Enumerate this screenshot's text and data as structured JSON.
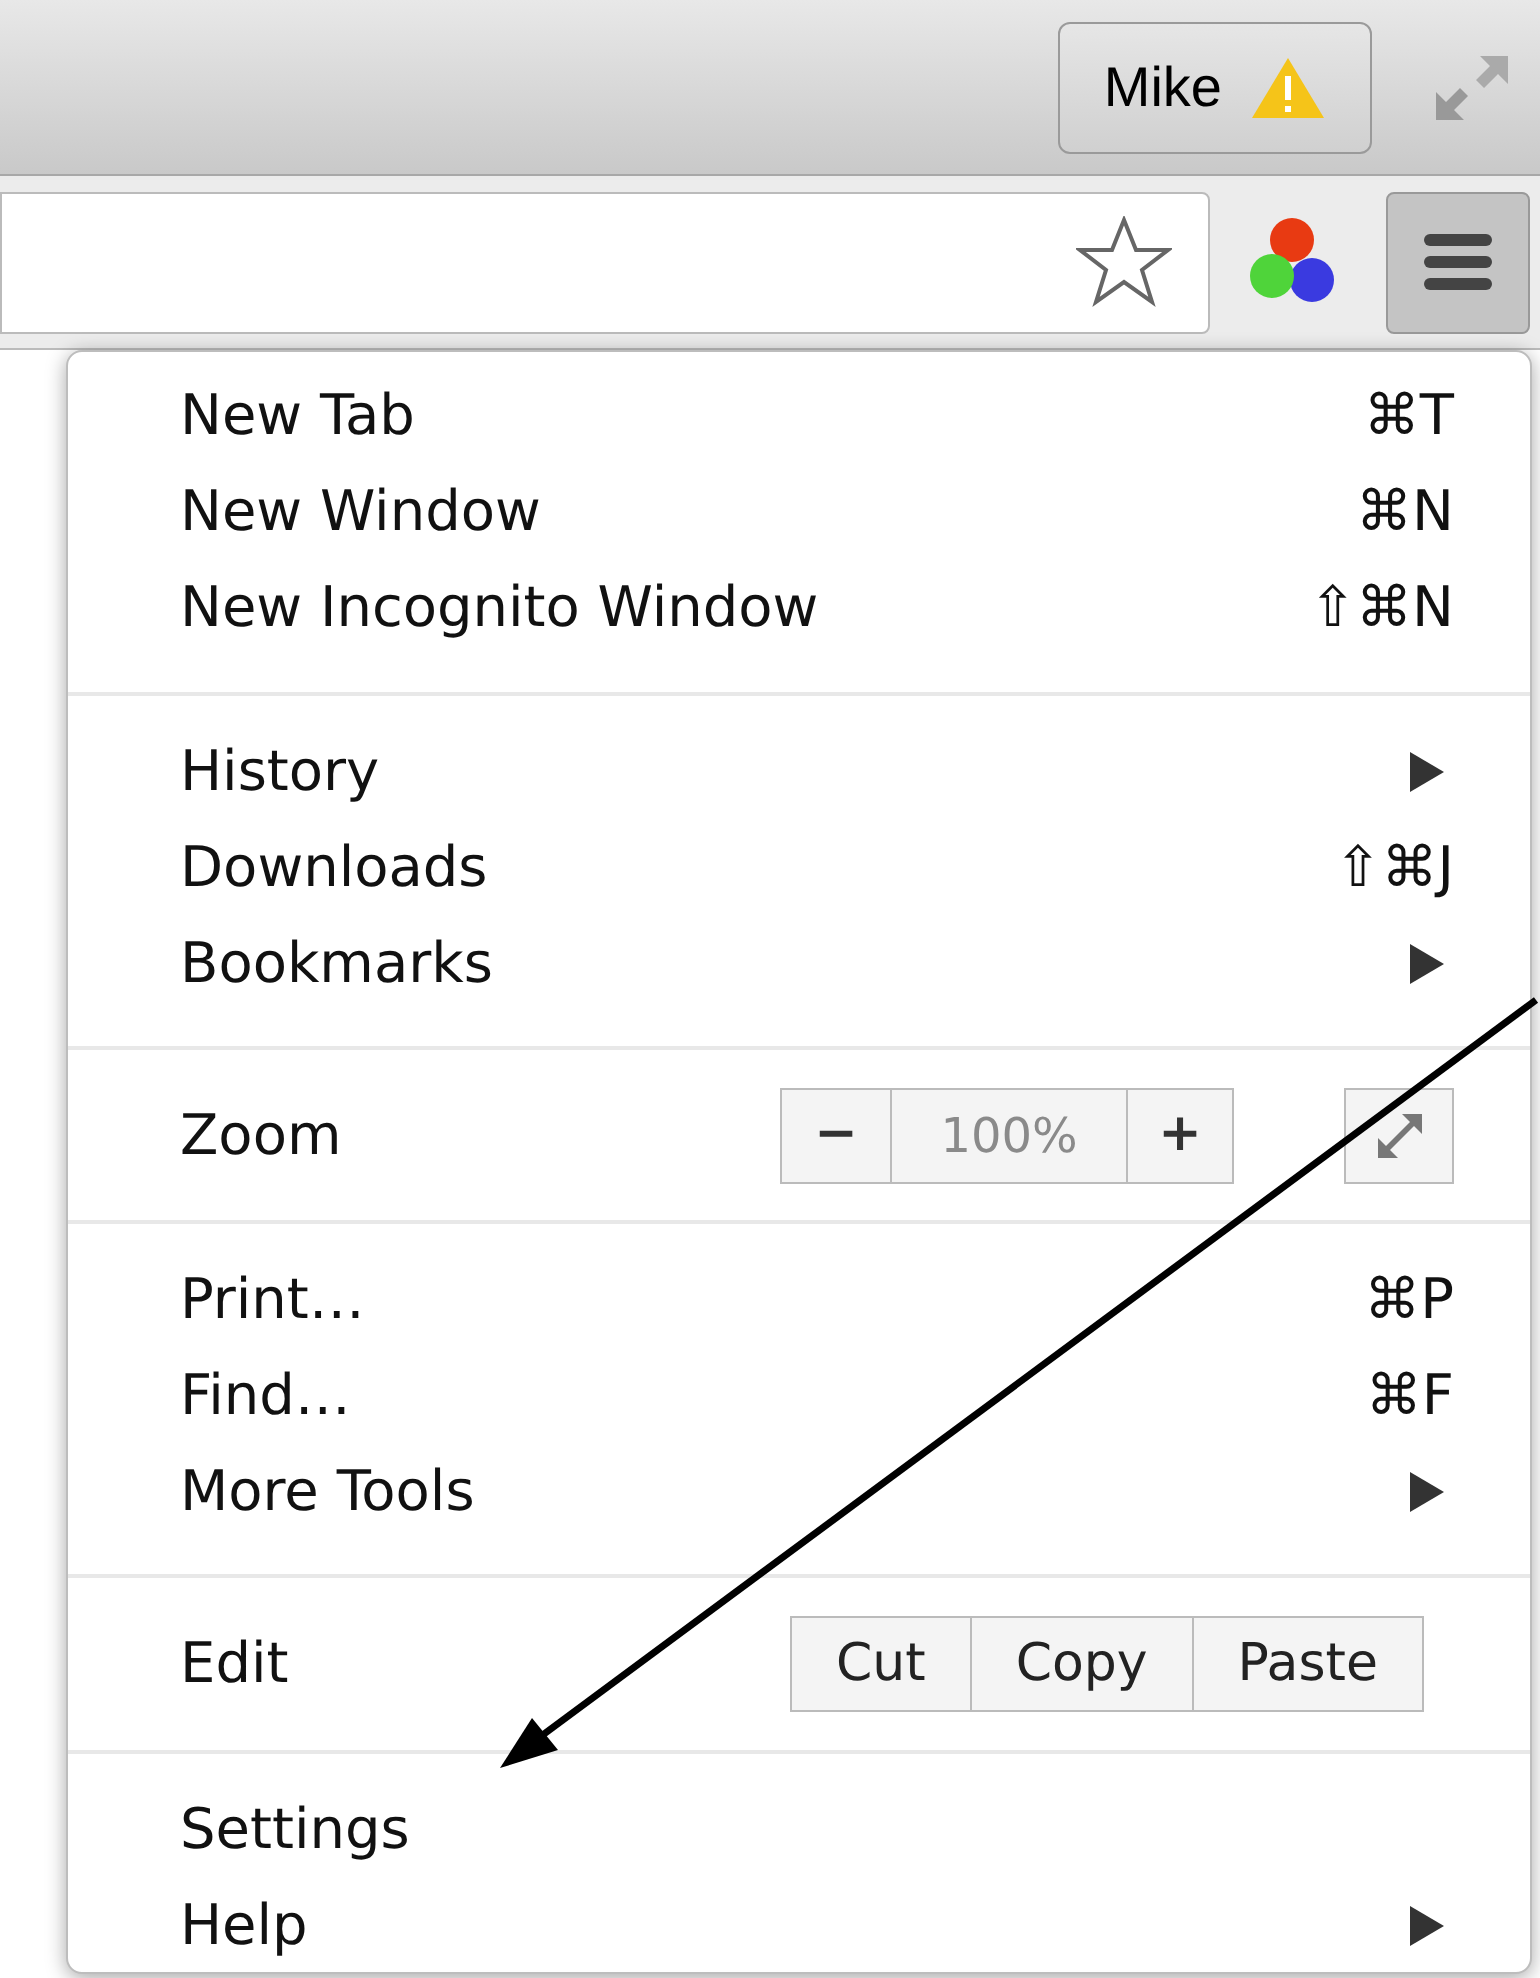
{
  "title_bar": {
    "profile_button": {
      "label": "Mike",
      "warning": true
    }
  },
  "menu": {
    "sections": [
      {
        "items": [
          {
            "kind": "command",
            "label": "New Tab",
            "shortcut": "⌘T"
          },
          {
            "kind": "command",
            "label": "New Window",
            "shortcut": "⌘N"
          },
          {
            "kind": "command",
            "label": "New Incognito Window",
            "shortcut": "⇧⌘N"
          }
        ]
      },
      {
        "items": [
          {
            "kind": "submenu",
            "label": "History"
          },
          {
            "kind": "command",
            "label": "Downloads",
            "shortcut": "⇧⌘J"
          },
          {
            "kind": "submenu",
            "label": "Bookmarks"
          }
        ]
      },
      {
        "items": [
          {
            "kind": "zoom",
            "label": "Zoom",
            "minus": "−",
            "value": "100%",
            "plus": "+"
          }
        ]
      },
      {
        "items": [
          {
            "kind": "command",
            "label": "Print…",
            "shortcut": "⌘P"
          },
          {
            "kind": "command",
            "label": "Find…",
            "shortcut": "⌘F"
          },
          {
            "kind": "submenu",
            "label": "More Tools"
          }
        ]
      },
      {
        "items": [
          {
            "kind": "edit",
            "label": "Edit",
            "buttons": [
              "Cut",
              "Copy",
              "Paste"
            ]
          }
        ]
      },
      {
        "items": [
          {
            "kind": "command",
            "label": "Settings"
          },
          {
            "kind": "submenu",
            "label": "Help"
          }
        ]
      }
    ]
  }
}
